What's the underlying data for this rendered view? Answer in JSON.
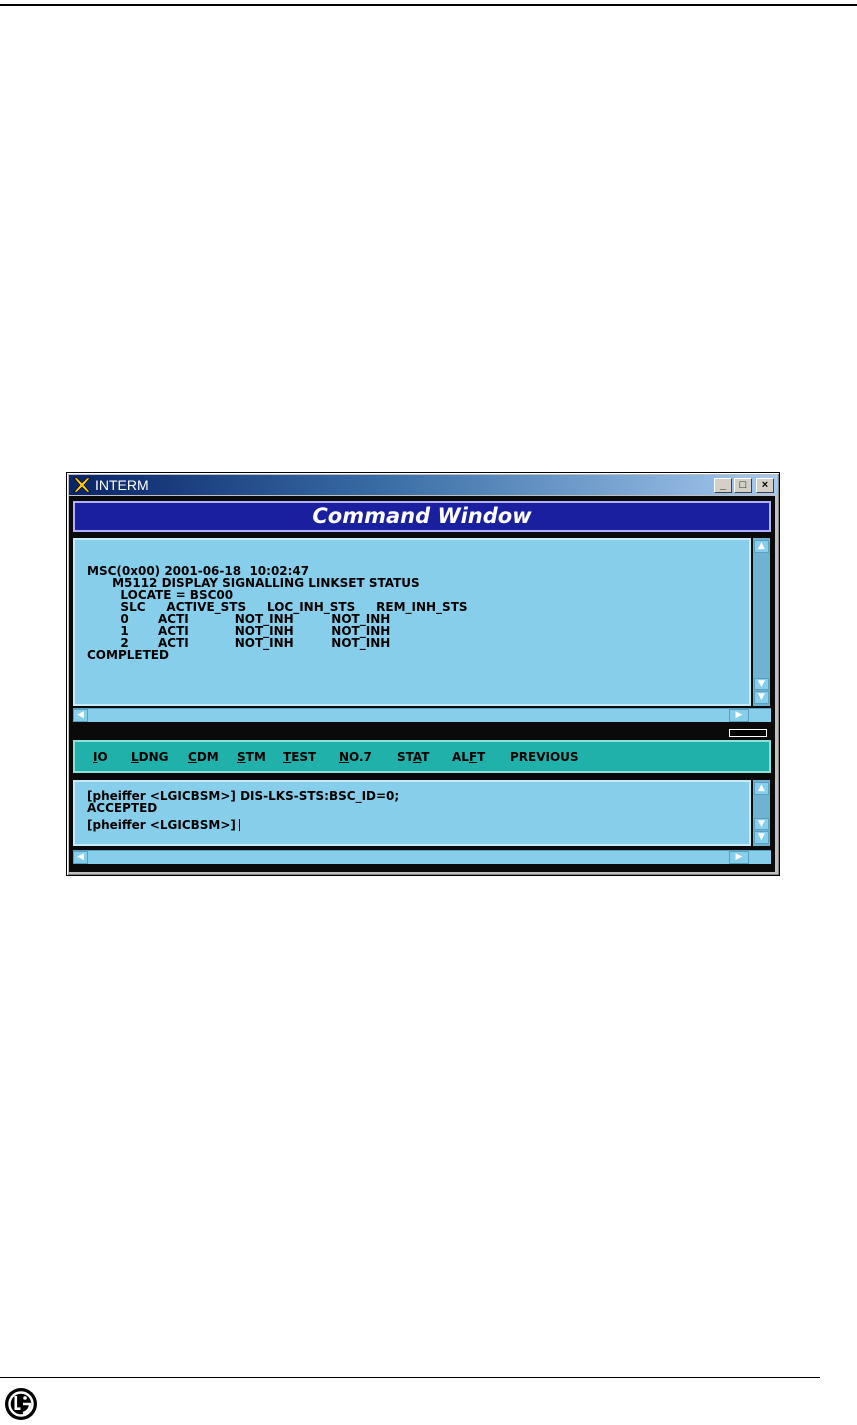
{
  "window": {
    "app_title": "INTERM",
    "command_window_title": "Command Window",
    "controls": {
      "minimize": "_",
      "maximize": "□",
      "close": "×"
    }
  },
  "output_pane": {
    "lines": [
      "MSC(0x00) 2001-06-18  10:02:47",
      "      M5112 DISPLAY SIGNALLING LINKSET STATUS",
      "        LOCATE = BSC00",
      "        SLC     ACTIVE_STS     LOC_INH_STS     REM_INH_STS",
      "        0       ACTI           NOT_INH         NOT_INH",
      "        1       ACTI           NOT_INH         NOT_INH",
      "        2       ACTI           NOT_INH         NOT_INH",
      "COMPLETED"
    ]
  },
  "menu": {
    "items": [
      {
        "pre": "",
        "u": "I",
        "post": "O"
      },
      {
        "pre": "",
        "u": "L",
        "post": "DNG"
      },
      {
        "pre": "",
        "u": "C",
        "post": "DM"
      },
      {
        "pre": "",
        "u": "S",
        "post": "TM"
      },
      {
        "pre": "",
        "u": "T",
        "post": "EST"
      },
      {
        "pre": "",
        "u": "N",
        "post": "O.7"
      },
      {
        "pre": "ST",
        "u": "A",
        "post": "T"
      },
      {
        "pre": "AL",
        "u": "F",
        "post": "T"
      },
      {
        "pre": "PREVIOUS",
        "u": "",
        "post": ""
      }
    ]
  },
  "input_pane": {
    "line1": "[pheiffer <LGICBSM>] DIS-LKS-STS:BSC_ID=0;",
    "line2": "ACCEPTED",
    "line3": "[pheiffer <LGICBSM>]"
  },
  "colors": {
    "titlebar": "#0a246a",
    "command_header": "#1a1fa0",
    "pane_bg": "#87ceeb",
    "menu_bg": "#20b2aa"
  },
  "icons": {
    "app": "x-icon",
    "logo": "lg-logo-icon"
  }
}
